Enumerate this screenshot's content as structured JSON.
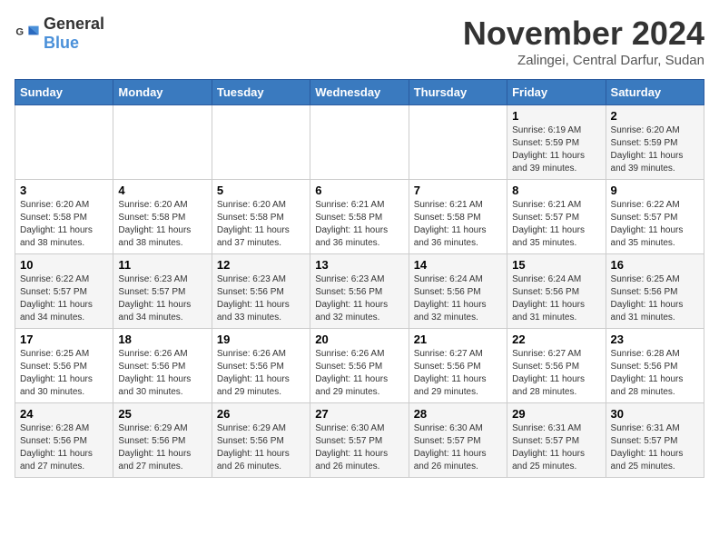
{
  "logo": {
    "general": "General",
    "blue": "Blue"
  },
  "title": "November 2024",
  "location": "Zalingei, Central Darfur, Sudan",
  "headers": [
    "Sunday",
    "Monday",
    "Tuesday",
    "Wednesday",
    "Thursday",
    "Friday",
    "Saturday"
  ],
  "weeks": [
    [
      {
        "day": "",
        "info": ""
      },
      {
        "day": "",
        "info": ""
      },
      {
        "day": "",
        "info": ""
      },
      {
        "day": "",
        "info": ""
      },
      {
        "day": "",
        "info": ""
      },
      {
        "day": "1",
        "info": "Sunrise: 6:19 AM\nSunset: 5:59 PM\nDaylight: 11 hours and 39 minutes."
      },
      {
        "day": "2",
        "info": "Sunrise: 6:20 AM\nSunset: 5:59 PM\nDaylight: 11 hours and 39 minutes."
      }
    ],
    [
      {
        "day": "3",
        "info": "Sunrise: 6:20 AM\nSunset: 5:58 PM\nDaylight: 11 hours and 38 minutes."
      },
      {
        "day": "4",
        "info": "Sunrise: 6:20 AM\nSunset: 5:58 PM\nDaylight: 11 hours and 38 minutes."
      },
      {
        "day": "5",
        "info": "Sunrise: 6:20 AM\nSunset: 5:58 PM\nDaylight: 11 hours and 37 minutes."
      },
      {
        "day": "6",
        "info": "Sunrise: 6:21 AM\nSunset: 5:58 PM\nDaylight: 11 hours and 36 minutes."
      },
      {
        "day": "7",
        "info": "Sunrise: 6:21 AM\nSunset: 5:58 PM\nDaylight: 11 hours and 36 minutes."
      },
      {
        "day": "8",
        "info": "Sunrise: 6:21 AM\nSunset: 5:57 PM\nDaylight: 11 hours and 35 minutes."
      },
      {
        "day": "9",
        "info": "Sunrise: 6:22 AM\nSunset: 5:57 PM\nDaylight: 11 hours and 35 minutes."
      }
    ],
    [
      {
        "day": "10",
        "info": "Sunrise: 6:22 AM\nSunset: 5:57 PM\nDaylight: 11 hours and 34 minutes."
      },
      {
        "day": "11",
        "info": "Sunrise: 6:23 AM\nSunset: 5:57 PM\nDaylight: 11 hours and 34 minutes."
      },
      {
        "day": "12",
        "info": "Sunrise: 6:23 AM\nSunset: 5:56 PM\nDaylight: 11 hours and 33 minutes."
      },
      {
        "day": "13",
        "info": "Sunrise: 6:23 AM\nSunset: 5:56 PM\nDaylight: 11 hours and 32 minutes."
      },
      {
        "day": "14",
        "info": "Sunrise: 6:24 AM\nSunset: 5:56 PM\nDaylight: 11 hours and 32 minutes."
      },
      {
        "day": "15",
        "info": "Sunrise: 6:24 AM\nSunset: 5:56 PM\nDaylight: 11 hours and 31 minutes."
      },
      {
        "day": "16",
        "info": "Sunrise: 6:25 AM\nSunset: 5:56 PM\nDaylight: 11 hours and 31 minutes."
      }
    ],
    [
      {
        "day": "17",
        "info": "Sunrise: 6:25 AM\nSunset: 5:56 PM\nDaylight: 11 hours and 30 minutes."
      },
      {
        "day": "18",
        "info": "Sunrise: 6:26 AM\nSunset: 5:56 PM\nDaylight: 11 hours and 30 minutes."
      },
      {
        "day": "19",
        "info": "Sunrise: 6:26 AM\nSunset: 5:56 PM\nDaylight: 11 hours and 29 minutes."
      },
      {
        "day": "20",
        "info": "Sunrise: 6:26 AM\nSunset: 5:56 PM\nDaylight: 11 hours and 29 minutes."
      },
      {
        "day": "21",
        "info": "Sunrise: 6:27 AM\nSunset: 5:56 PM\nDaylight: 11 hours and 29 minutes."
      },
      {
        "day": "22",
        "info": "Sunrise: 6:27 AM\nSunset: 5:56 PM\nDaylight: 11 hours and 28 minutes."
      },
      {
        "day": "23",
        "info": "Sunrise: 6:28 AM\nSunset: 5:56 PM\nDaylight: 11 hours and 28 minutes."
      }
    ],
    [
      {
        "day": "24",
        "info": "Sunrise: 6:28 AM\nSunset: 5:56 PM\nDaylight: 11 hours and 27 minutes."
      },
      {
        "day": "25",
        "info": "Sunrise: 6:29 AM\nSunset: 5:56 PM\nDaylight: 11 hours and 27 minutes."
      },
      {
        "day": "26",
        "info": "Sunrise: 6:29 AM\nSunset: 5:56 PM\nDaylight: 11 hours and 26 minutes."
      },
      {
        "day": "27",
        "info": "Sunrise: 6:30 AM\nSunset: 5:57 PM\nDaylight: 11 hours and 26 minutes."
      },
      {
        "day": "28",
        "info": "Sunrise: 6:30 AM\nSunset: 5:57 PM\nDaylight: 11 hours and 26 minutes."
      },
      {
        "day": "29",
        "info": "Sunrise: 6:31 AM\nSunset: 5:57 PM\nDaylight: 11 hours and 25 minutes."
      },
      {
        "day": "30",
        "info": "Sunrise: 6:31 AM\nSunset: 5:57 PM\nDaylight: 11 hours and 25 minutes."
      }
    ]
  ]
}
